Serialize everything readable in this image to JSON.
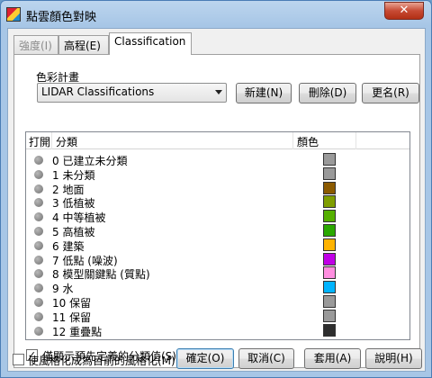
{
  "window": {
    "title": "點雲顏色對映",
    "close_glyph": "✕"
  },
  "tabs": [
    {
      "label": "強度(I)",
      "state": "disabled"
    },
    {
      "label": "高程(E)",
      "state": "normal"
    },
    {
      "label": "Classification",
      "state": "active"
    }
  ],
  "color_scheme": {
    "group_label": "色彩計畫",
    "selected": "LIDAR Classifications",
    "new_button": "新建(N)",
    "delete_button": "刪除(D)",
    "rename_button": "更名(R)"
  },
  "list": {
    "columns": {
      "on": "打開",
      "classification": "分類",
      "color": "顏色"
    },
    "rows": [
      {
        "label": "0 已建立未分類",
        "color": "#9a9a9a"
      },
      {
        "label": "1 未分類",
        "color": "#9a9a9a"
      },
      {
        "label": "2 地面",
        "color": "#8b5a00"
      },
      {
        "label": "3 低植被",
        "color": "#7f9e00"
      },
      {
        "label": "4 中等植被",
        "color": "#55b000"
      },
      {
        "label": "5 高植被",
        "color": "#2aa800"
      },
      {
        "label": "6 建築",
        "color": "#ffb300"
      },
      {
        "label": "7 低點 (噪波)",
        "color": "#c000e6"
      },
      {
        "label": "8 模型關鍵點 (質點)",
        "color": "#ff8ee0"
      },
      {
        "label": "9 水",
        "color": "#00b4ff"
      },
      {
        "label": "10 保留",
        "color": "#9a9a9a"
      },
      {
        "label": "11 保留",
        "color": "#9a9a9a"
      },
      {
        "label": "12 重疊點",
        "color": "#2e2e2e"
      }
    ]
  },
  "show_predefined": {
    "label": "僅顯示預先定義的分類值(S)",
    "checked": true
  },
  "bottom": {
    "use_raster": {
      "label": "使風格化成為目前的風格化(M)",
      "checked": false
    },
    "ok": "確定(O)",
    "cancel": "取消(C)",
    "apply": "套用(A)",
    "help": "說明(H)"
  }
}
